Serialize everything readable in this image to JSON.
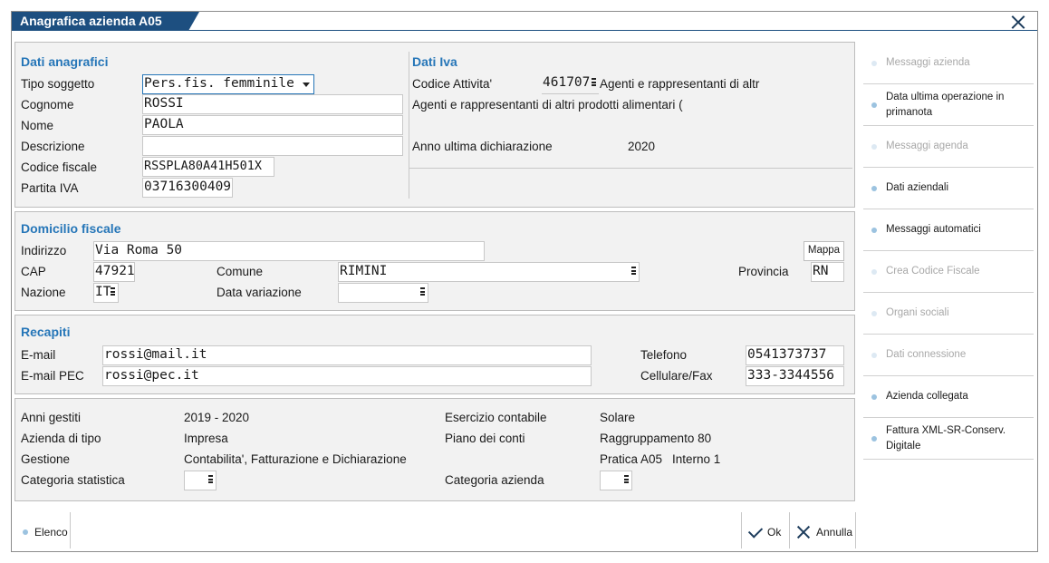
{
  "window": {
    "title": "Anagrafica azienda A05"
  },
  "dati_anagrafici": {
    "title": "Dati anagrafici",
    "tipo_soggetto_label": "Tipo soggetto",
    "tipo_soggetto_value": "Pers.fis. femminile",
    "cognome_label": "Cognome",
    "cognome_value": "ROSSI",
    "nome_label": "Nome",
    "nome_value": "PAOLA",
    "descrizione_label": "Descrizione",
    "descrizione_value": "",
    "codice_fiscale_label": "Codice fiscale",
    "codice_fiscale_value": "RSSPLA80A41H501X",
    "partita_iva_label": "Partita IVA",
    "partita_iva_value": "03716300409"
  },
  "dati_iva": {
    "title": "Dati Iva",
    "codice_attivita_label": "Codice Attivita'",
    "codice_attivita_value": "461707",
    "codice_attivita_desc_short": "Agenti e rappresentanti di altr",
    "codice_attivita_desc_long": "Agenti e rappresentanti di altri prodotti alimentari (",
    "anno_label": "Anno ultima dichiarazione",
    "anno_value": "2020"
  },
  "domicilio": {
    "title": "Domicilio fiscale",
    "indirizzo_label": "Indirizzo",
    "indirizzo_value": "Via Roma 50",
    "mappa_button": "Mappa",
    "cap_label": "CAP",
    "cap_value": "47921",
    "comune_label": "Comune",
    "comune_value": "RIMINI",
    "provincia_label": "Provincia",
    "provincia_value": "RN",
    "nazione_label": "Nazione",
    "nazione_value": "IT",
    "data_variazione_label": "Data variazione",
    "data_variazione_value": ""
  },
  "recapiti": {
    "title": "Recapiti",
    "email_label": "E-mail",
    "email_value": "rossi@mail.it",
    "pec_label": "E-mail PEC",
    "pec_value": "rossi@pec.it",
    "telefono_label": "Telefono",
    "telefono_value": "0541373737",
    "cellulare_label": "Cellulare/Fax",
    "cellulare_value": "333-3344556"
  },
  "info": {
    "anni_label": "Anni gestiti",
    "anni_value": "2019 - 2020",
    "tipo_label": "Azienda di tipo",
    "tipo_value": "Impresa",
    "gestione_label": "Gestione",
    "gestione_value": "Contabilita', Fatturazione e Dichiarazione",
    "categoria_stat_label": "Categoria statistica",
    "esercizio_label": "Esercizio contabile",
    "esercizio_value": "Solare",
    "piano_label": "Piano dei conti",
    "piano_value": "Raggruppamento 80",
    "pratica_value": "Pratica A05",
    "interno_value": "Interno 1",
    "categoria_az_label": "Categoria azienda"
  },
  "sidebar": {
    "items": [
      {
        "label": "Messaggi azienda",
        "enabled": false
      },
      {
        "label": "Data ultima operazione in primanota",
        "enabled": true
      },
      {
        "label": "Messaggi agenda",
        "enabled": false
      },
      {
        "label": "Dati aziendali",
        "enabled": true
      },
      {
        "label": "Messaggi automatici",
        "enabled": true
      },
      {
        "label": "Crea Codice Fiscale",
        "enabled": false
      },
      {
        "label": "Organi sociali",
        "enabled": false
      },
      {
        "label": "Dati connessione",
        "enabled": false
      },
      {
        "label": "Azienda collegata",
        "enabled": true
      },
      {
        "label": "Fattura XML-SR-Conserv. Digitale",
        "enabled": true
      }
    ]
  },
  "footer": {
    "elenco": "Elenco",
    "ok": "Ok",
    "annulla": "Annulla"
  }
}
